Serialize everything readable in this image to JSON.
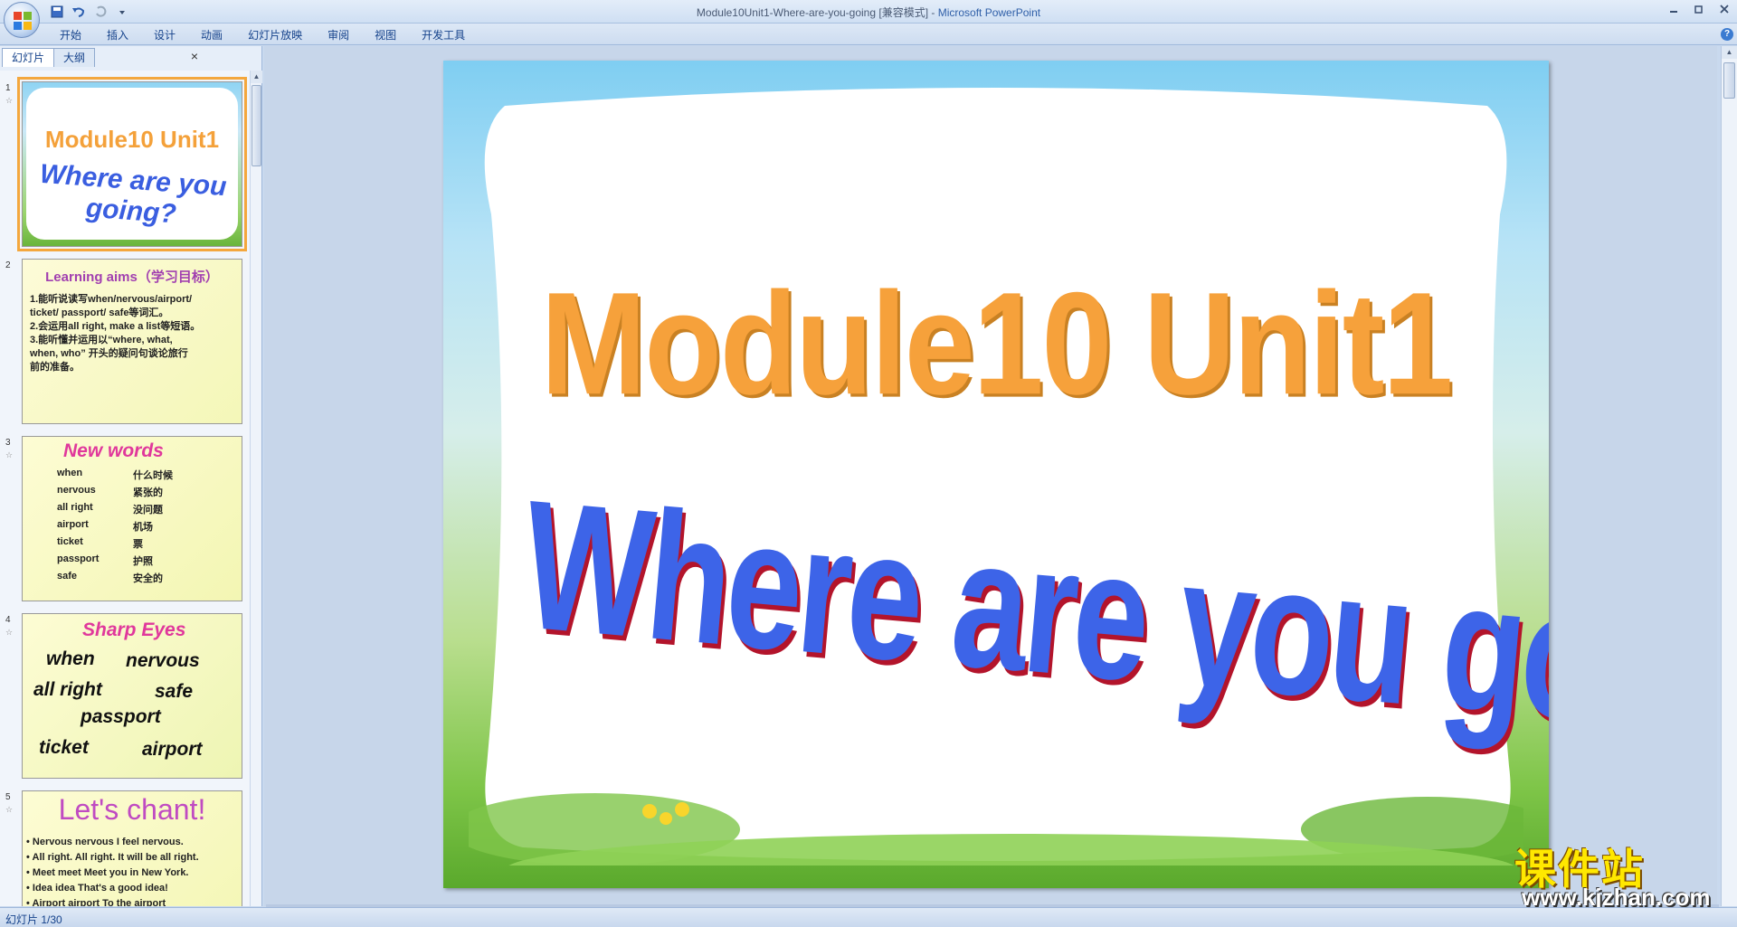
{
  "window": {
    "title_doc": "Module10Unit1-Where-are-you-going [兼容模式]",
    "title_sep": " - ",
    "title_app": "Microsoft PowerPoint"
  },
  "ribbon_tabs": [
    "开始",
    "插入",
    "设计",
    "动画",
    "幻灯片放映",
    "审阅",
    "视图",
    "开发工具"
  ],
  "left_pane": {
    "tabs": [
      "幻灯片",
      "大纲"
    ],
    "close": "×"
  },
  "thumbnails": [
    {
      "num": "1",
      "title_line1": "Module10 Unit1",
      "title_line2": "Where are you going?"
    },
    {
      "num": "2",
      "heading": "Learning aims（学习目标）",
      "lines": [
        "1.能听说读写when/nervous/airport/",
        "ticket/ passport/  safe等词汇。",
        "2.会运用all right, make a list等短语。",
        "3.能听懂并运用以“where, what,",
        "when, who” 开头的疑问句谈论旅行",
        "前的准备。"
      ]
    },
    {
      "num": "3",
      "heading": "New words",
      "words": [
        [
          "when",
          "什么时候"
        ],
        [
          "nervous",
          "紧张的"
        ],
        [
          "all right",
          "没问题"
        ],
        [
          "airport",
          "机场"
        ],
        [
          "ticket",
          "票"
        ],
        [
          "passport",
          "护照"
        ],
        [
          "safe",
          "安全的"
        ]
      ]
    },
    {
      "num": "4",
      "heading": "Sharp Eyes",
      "words": [
        "when",
        "nervous",
        "all right",
        "safe",
        "passport",
        "ticket",
        "airport"
      ]
    },
    {
      "num": "5",
      "heading": "Let's chant!",
      "lines": [
        "• Nervous nervous   I feel nervous.",
        "• All right. All right.  It will be all right.",
        "• Meet meet  Meet you in New York.",
        "• Idea idea   That's a good idea!",
        "• Airport airport   To the airport"
      ]
    }
  ],
  "slide": {
    "title_line1": "Module10 Unit1",
    "title_line2": "Where are you going?"
  },
  "watermark": {
    "cn": "课件站",
    "url": "www.kjzhan.com"
  },
  "status": {
    "text": "幻灯片 1/30"
  },
  "colors": {
    "title_orange": "#f6a13b",
    "title_blue": "#3d64e8",
    "selection": "#f4a73d"
  }
}
